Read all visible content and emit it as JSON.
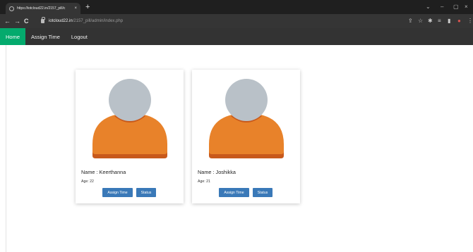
{
  "browser": {
    "tab_title": "https://iotcloud22.in/2157_pill/c",
    "tab_close": "×",
    "new_tab": "+",
    "url_host": "iotcloud22.in",
    "url_path": "/2157_pill/admin/index.php",
    "nav": {
      "back": "←",
      "forward": "→",
      "reload": "C"
    },
    "window_controls": {
      "chevron": "⌄",
      "minimize": "–",
      "maximize": "▢",
      "close": "×"
    },
    "toolbar_icons": [
      "share-icon",
      "star-icon",
      "extension-icon",
      "reading-list-icon",
      "sidebar-icon",
      "profile-icon",
      "menu-icon"
    ]
  },
  "nav": {
    "items": [
      {
        "label": "Home",
        "active": true
      },
      {
        "label": "Assign Time",
        "active": false
      },
      {
        "label": "Logout",
        "active": false
      }
    ]
  },
  "colors": {
    "nav_bg": "#333333",
    "nav_active": "#04aa6d",
    "button": "#3a79b8",
    "avatar_head": "#b9c1c8",
    "avatar_body": "#e8822a",
    "avatar_body_shadow": "#c8591b"
  },
  "cards": [
    {
      "name": "Name : Keerthanna",
      "age": "Age: 22",
      "assign_label": "Assign Time",
      "status_label": "Status"
    },
    {
      "name": "Name : Joshikka",
      "age": "Age: 21",
      "assign_label": "Assign Time",
      "status_label": "Status"
    }
  ]
}
